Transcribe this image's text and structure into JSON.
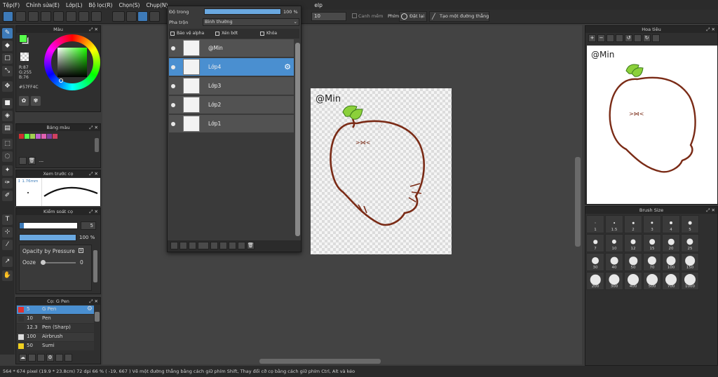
{
  "menu": [
    "Tệp(F)",
    "Chỉnh sửa(E)",
    "Lớp(L)",
    "Bộ lọc(R)",
    "Chọn(S)",
    "Chụp(N)",
    "elp"
  ],
  "toolbar": {
    "field_value": "10",
    "checkbox_label": "Canh mềm",
    "phim_label": "Phím",
    "reset_label": "Đặt lại",
    "ruler_label": "Tạo một đường thẳng"
  },
  "color_panel": {
    "title": "Màu",
    "r": "R:87",
    "g": "G:255",
    "b": "B:76",
    "hex": "#57FF4C",
    "fg": "#57ff4c"
  },
  "palette_panel": {
    "title": "Bảng màu",
    "swatches": [
      "#d03030",
      "#57ff4c",
      "#a0d050",
      "#c060d0",
      "#e060b0",
      "#8040a0",
      "#d04060"
    ],
    "ellipsis": "---"
  },
  "preview_panel": {
    "title": "Xem trước cọ",
    "size": "1.76mm"
  },
  "brush_control": {
    "title": "Kiểm soát cọ",
    "size_value": "5",
    "opacity_value": "100 %",
    "opacity_fraction": 1.0,
    "pressure_label": "Opacity by Pressure",
    "ooze_label": "Ooze",
    "ooze_value": "0"
  },
  "brush_list": {
    "title": "Cọ: G Pen",
    "items": [
      {
        "size": "5",
        "name": "G Pen",
        "color": "#e03030",
        "selected": true
      },
      {
        "size": "10",
        "name": "Pen",
        "color": "#333333",
        "selected": false
      },
      {
        "size": "12.3",
        "name": "Pen (Sharp)",
        "color": "#333333",
        "selected": false
      },
      {
        "size": "100",
        "name": "Airbrush",
        "color": "#dddddd",
        "selected": false
      },
      {
        "size": "50",
        "name": "Sumi",
        "color": "#f0d020",
        "selected": false
      }
    ]
  },
  "layers": {
    "opacity_label": "Độ trong",
    "opacity_value": "100 %",
    "opacity_fraction": 1.0,
    "blend_label": "Pha trộn",
    "blend_value": "Bình thường",
    "protect_alpha": "Bảo vệ alpha",
    "clipping": "Xén bớt",
    "lock": "Khóa",
    "items": [
      {
        "name": "@Min",
        "selected": false
      },
      {
        "name": "Lớp4",
        "selected": true
      },
      {
        "name": "Lớp3",
        "selected": false
      },
      {
        "name": "Lớp2",
        "selected": false
      },
      {
        "name": "Lớp1",
        "selected": false
      }
    ]
  },
  "canvas": {
    "signature": "@Min"
  },
  "navigator": {
    "title": "Hoa tiêu",
    "signature": "@Min"
  },
  "brush_size": {
    "title": "Brush Size",
    "sizes": [
      "1",
      "1.5",
      "2",
      "3",
      "4",
      "5",
      "7",
      "10",
      "12",
      "15",
      "20",
      "25",
      "30",
      "40",
      "50",
      "70",
      "100",
      "150",
      "200",
      "300",
      "400",
      "500",
      "700",
      "1000"
    ]
  },
  "status": "564 * 674 pixel   (19.9 * 23.8cm)   72 dpi   66 %   ( -19, 667 )   Vẽ một đường thẳng bằng cách giữ phím Shift, Thay đổi cỡ cọ bằng cách giữ phím Ctrl, Alt và kéo"
}
